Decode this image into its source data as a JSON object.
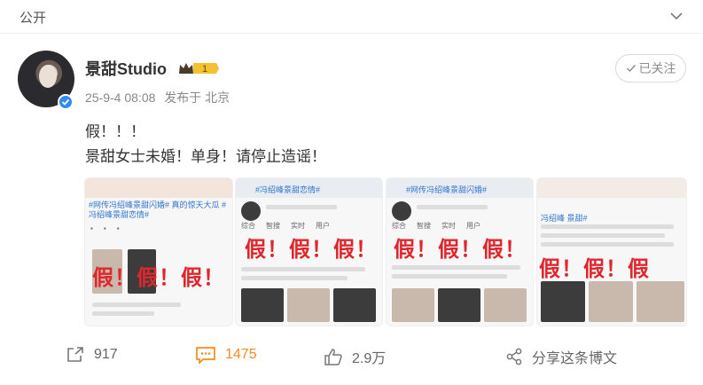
{
  "header": {
    "visibility": "公开"
  },
  "post": {
    "author": "景甜Studio",
    "vip_level": "1",
    "timestamp": "25-9-4 08:08",
    "source": "发布于 北京",
    "follow_label": "已关注",
    "lines": [
      "假！！！",
      "景甜女士未婚！单身！请停止造谣！"
    ]
  },
  "images": [
    {
      "tags": "#网传冯绍峰景甜闪婚# 真的惊天大瓜 #冯绍峰景甜恋情#",
      "stamp": "假！假！假！"
    },
    {
      "tags": "#冯绍峰景甜恋情#",
      "stamp": "假！假！假！"
    },
    {
      "tags": "#网传冯绍峰景甜闪婚#",
      "stamp": "假！假！假！"
    },
    {
      "tags": "冯绍峰 景甜#",
      "stamp": "假！假！假"
    }
  ],
  "actions": {
    "repost_count": "917",
    "comment_count": "1475",
    "like_count": "2.9万",
    "share_label": "分享这条博文"
  },
  "colors": {
    "accent": "#f78b1f",
    "fake_red": "#e0262d",
    "verify_blue": "#2f8cf0"
  }
}
